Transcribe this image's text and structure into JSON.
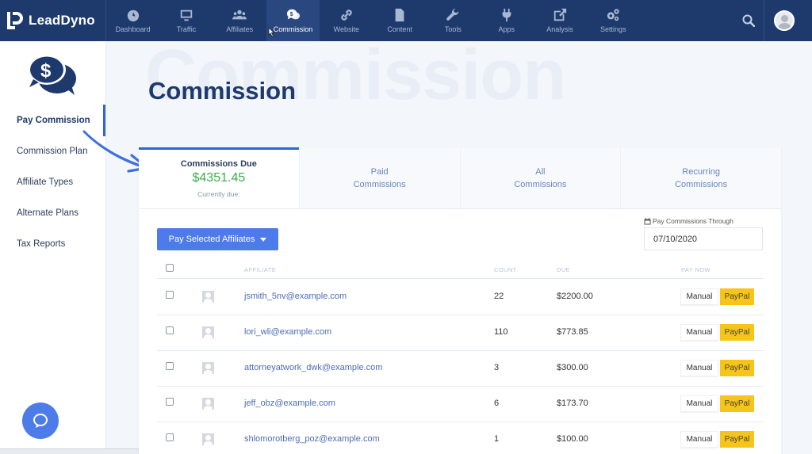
{
  "brand": {
    "name": "LeadDyno"
  },
  "nav": {
    "items": [
      {
        "label": "Dashboard",
        "icon": "gauge-icon"
      },
      {
        "label": "Traffic",
        "icon": "monitor-icon"
      },
      {
        "label": "Affiliates",
        "icon": "users-icon"
      },
      {
        "label": "Commission",
        "icon": "money-chat-icon",
        "active": true
      },
      {
        "label": "Website",
        "icon": "link-icon"
      },
      {
        "label": "Content",
        "icon": "file-icon"
      },
      {
        "label": "Tools",
        "icon": "wrench-icon"
      },
      {
        "label": "Apps",
        "icon": "plug-icon"
      },
      {
        "label": "Analysis",
        "icon": "external-edit-icon"
      },
      {
        "label": "Settings",
        "icon": "gears-icon"
      }
    ]
  },
  "sidebar": {
    "items": [
      {
        "label": "Pay Commission",
        "active": true
      },
      {
        "label": "Commission Plan"
      },
      {
        "label": "Affiliate Types"
      },
      {
        "label": "Alternate Plans"
      },
      {
        "label": "Tax Reports"
      }
    ]
  },
  "page": {
    "watermark": "Commission",
    "title": "Commission"
  },
  "tabs": {
    "due": {
      "title": "Commissions Due",
      "amount": "$4351.45",
      "sub": "Currently due:"
    },
    "paid": {
      "line1": "Paid",
      "line2": "Commissions"
    },
    "all": {
      "line1": "All",
      "line2": "Commissions"
    },
    "recurring": {
      "line1": "Recurring",
      "line2": "Commissions"
    }
  },
  "controls": {
    "pay_selected": "Pay Selected Affiliates",
    "through_label": "Pay Commissions Through",
    "through_date": "07/10/2020"
  },
  "table": {
    "headers": {
      "affiliate": "AFFILIATE",
      "count": "COUNT",
      "due": "DUE",
      "pay_now": "PAY NOW"
    },
    "manual_label": "Manual",
    "paypal_label": "PayPal",
    "rows": [
      {
        "email": "jsmith_5nv@example.com",
        "count": "22",
        "due": "$2200.00"
      },
      {
        "email": "lori_wli@example.com",
        "count": "110",
        "due": "$773.85"
      },
      {
        "email": "attorneyatwork_dwk@example.com",
        "count": "3",
        "due": "$300.00"
      },
      {
        "email": "jeff_obz@example.com",
        "count": "6",
        "due": "$173.70"
      },
      {
        "email": "shlomorotberg_poz@example.com",
        "count": "1",
        "due": "$100.00"
      }
    ]
  },
  "colors": {
    "nav_bg": "#1e3a6d",
    "accent": "#4d7be9",
    "due_green": "#3cab4a",
    "paypal": "#f6c51a"
  }
}
